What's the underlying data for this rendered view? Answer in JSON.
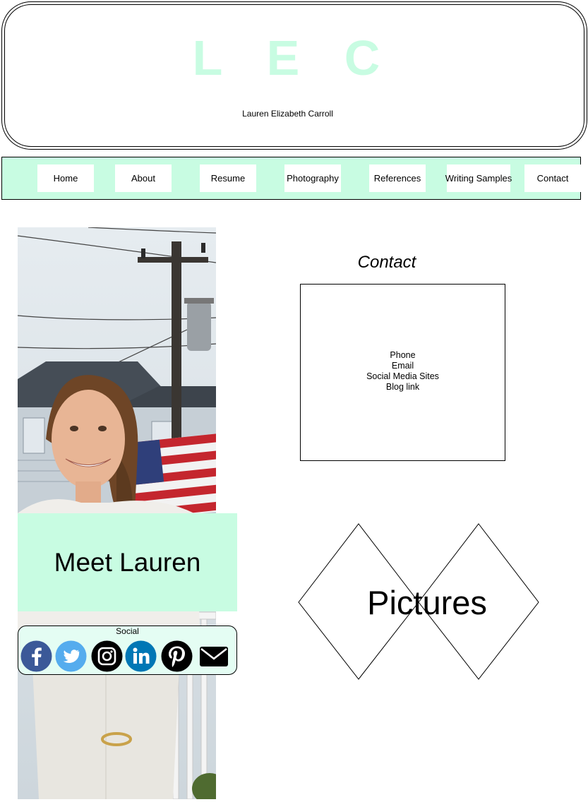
{
  "header": {
    "logo": "L E C",
    "full_name": "Lauren Elizabeth Carroll"
  },
  "nav": {
    "items": [
      "Home",
      "About",
      "Resume",
      "Photography",
      "References",
      "Writing Samples",
      "Contact"
    ]
  },
  "profile": {
    "meet_label": "Meet Lauren",
    "social_label": "Social",
    "social_icons": [
      "facebook-icon",
      "twitter-icon",
      "instagram-icon",
      "linkedin-icon",
      "pinterest-icon",
      "email-icon"
    ]
  },
  "contact": {
    "title": "Contact",
    "items": [
      "Phone",
      "Email",
      "Social Media Sites",
      "Blog link"
    ]
  },
  "pictures": {
    "label": "Pictures"
  },
  "colors": {
    "accent": "#c8fce2",
    "facebook": "#3b5998",
    "twitter": "#55acee",
    "linkedin": "#0077b5"
  }
}
